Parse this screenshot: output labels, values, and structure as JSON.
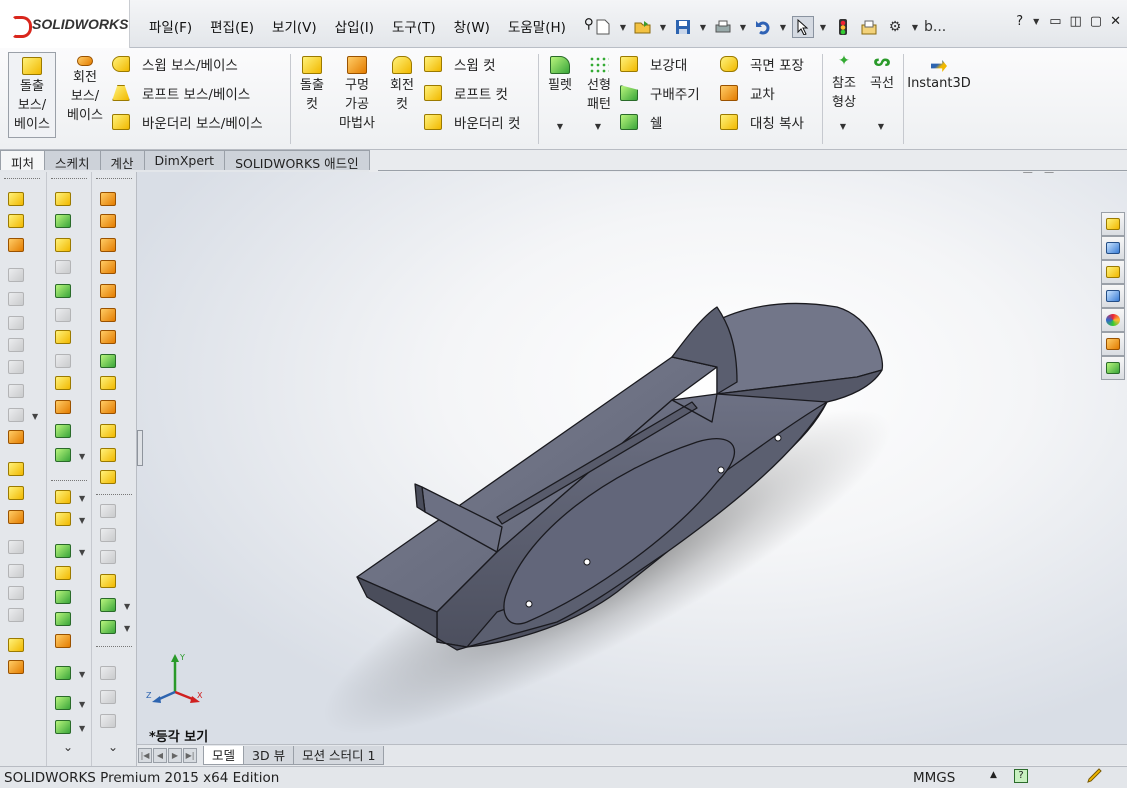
{
  "app": {
    "brand": "SOLIDWORKS",
    "menu": [
      "파일(F)",
      "편집(E)",
      "보기(V)",
      "삽입(I)",
      "도구(T)",
      "창(W)",
      "도움말(H)"
    ],
    "quick_more": "b...",
    "help_glyph": "?"
  },
  "command_manager": {
    "extrude_boss": [
      "돌출",
      "보스/",
      "베이스"
    ],
    "revolve_boss": [
      "회전",
      "보스/",
      "베이스"
    ],
    "sweep_boss": "스윕 보스/베이스",
    "loft_boss": "로프트 보스/베이스",
    "boundary_boss": "바운더리 보스/베이스",
    "extrude_cut": [
      "돌출",
      "컷"
    ],
    "hole_wizard": [
      "구멍",
      "가공",
      "마법사"
    ],
    "revolve_cut": [
      "회전",
      "컷"
    ],
    "sweep_cut": "스윕 컷",
    "loft_cut": "로프트 컷",
    "boundary_cut": "바운더리 컷",
    "fillet": "필렛",
    "linear_pattern": [
      "선형",
      "패턴"
    ],
    "rib": "보강대",
    "draft": "구배주기",
    "shell": "쉘",
    "wrap": "곡면 포장",
    "intersect": "교차",
    "mirror": "대칭 복사",
    "ref_geometry": [
      "참조",
      "형상"
    ],
    "curves": "곡선",
    "instant3d": "Instant3D"
  },
  "tabs": [
    "피처",
    "스케치",
    "계산",
    "DimXpert",
    "SOLIDWORKS 애드인"
  ],
  "active_tab": "피처",
  "viewport": {
    "view_label": "*등각 보기",
    "triad_axes": {
      "y": "Y",
      "z": "Z",
      "x": "X"
    }
  },
  "bottom_tabs": [
    "모델",
    "3D 뷰",
    "모션 스터디 1"
  ],
  "active_bottom_tab": "모델",
  "status": {
    "product": "SOLIDWORKS Premium 2015 x64 Edition",
    "units": "MMGS"
  },
  "colors": {
    "model_fill": "#6f7385",
    "model_edge": "#1a1a1f",
    "brand_red": "#d9261c"
  }
}
